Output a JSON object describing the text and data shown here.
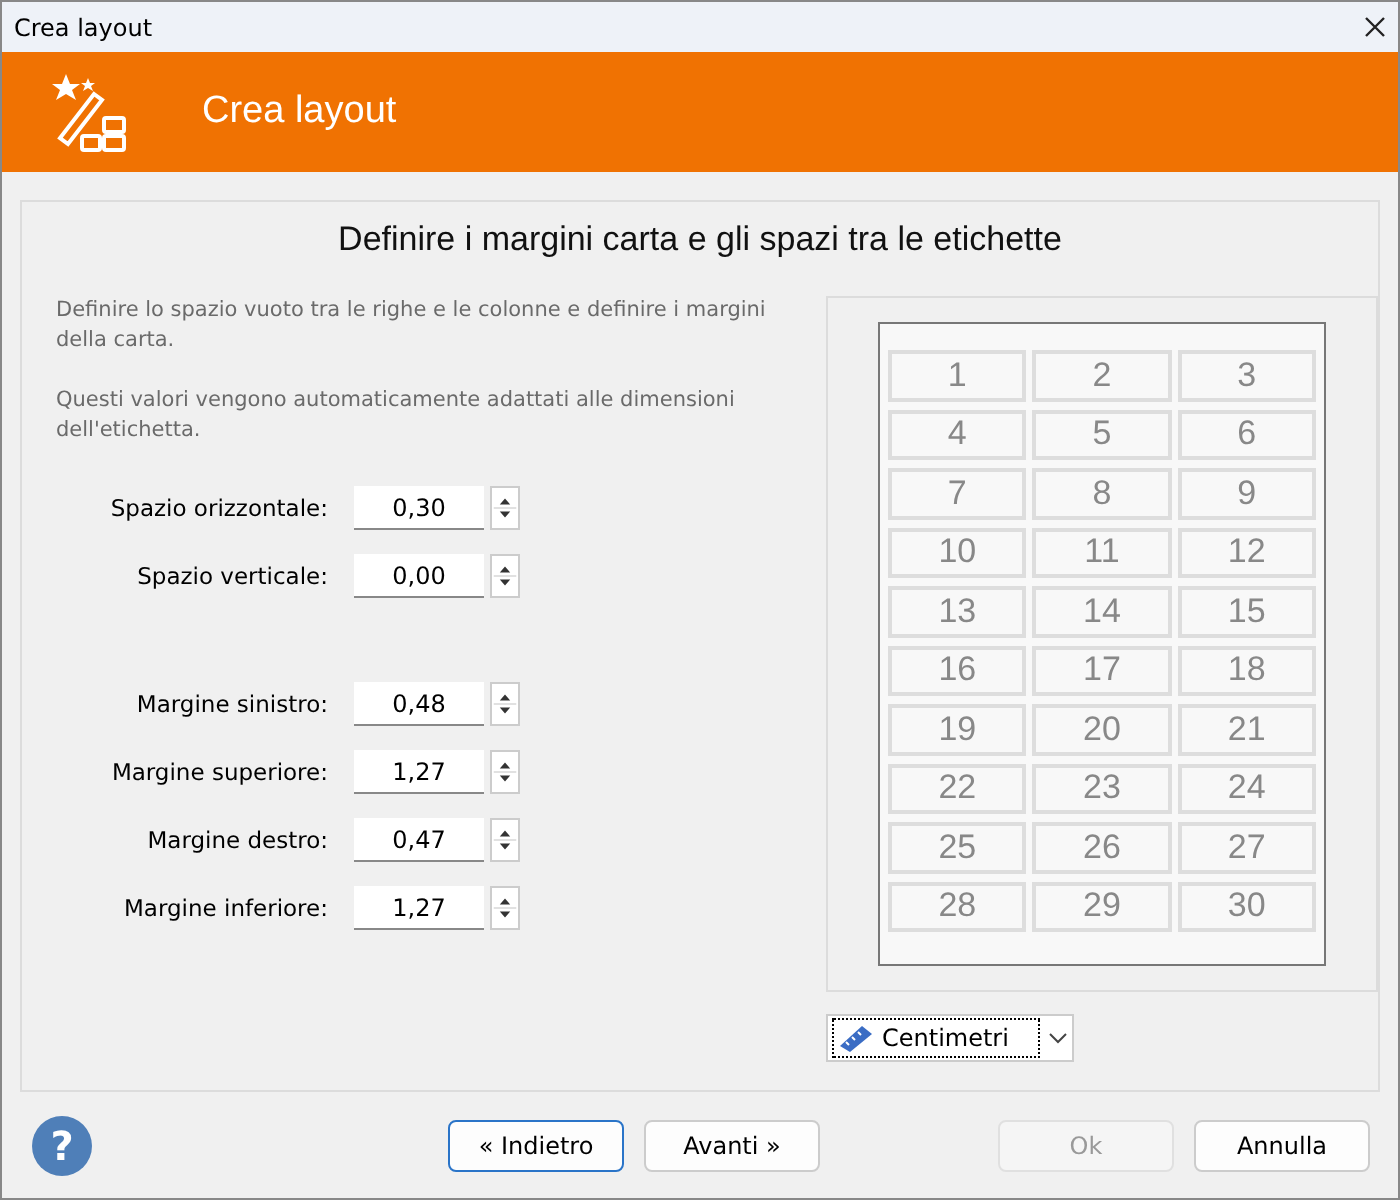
{
  "window": {
    "title": "Crea layout"
  },
  "header": {
    "title": "Crea layout"
  },
  "page": {
    "heading": "Definire i margini carta e gli spazi tra le etichette",
    "paragraphs": [
      "Definire lo spazio vuoto tra le righe e le colonne e definire i margini della carta.",
      "Questi valori vengono automaticamente adattati alle dimensioni dell'etichetta."
    ],
    "field_groups": [
      [
        {
          "label": "Spazio orizzontale:",
          "value": "0,30"
        },
        {
          "label": "Spazio verticale:",
          "value": "0,00"
        }
      ],
      [
        {
          "label": "Margine sinistro:",
          "value": "0,48"
        },
        {
          "label": "Margine superiore:",
          "value": "1,27"
        },
        {
          "label": "Margine destro:",
          "value": "0,47"
        },
        {
          "label": "Margine inferiore:",
          "value": "1,27"
        }
      ]
    ],
    "preview": {
      "labels": [
        "1",
        "2",
        "3",
        "4",
        "5",
        "6",
        "7",
        "8",
        "9",
        "10",
        "11",
        "12",
        "13",
        "14",
        "15",
        "16",
        "17",
        "18",
        "19",
        "20",
        "21",
        "22",
        "23",
        "24",
        "25",
        "26",
        "27",
        "28",
        "29",
        "30"
      ]
    },
    "unit": {
      "value": "Centimetri"
    }
  },
  "footer": {
    "help": "?",
    "nav_buttons": [
      {
        "label": "« Indietro",
        "focused": true,
        "disabled": false
      },
      {
        "label": "Avanti »",
        "focused": false,
        "disabled": false
      }
    ],
    "dialog_buttons": [
      {
        "label": "Ok",
        "focused": false,
        "disabled": true
      },
      {
        "label": "Annulla",
        "focused": false,
        "disabled": false
      }
    ]
  }
}
